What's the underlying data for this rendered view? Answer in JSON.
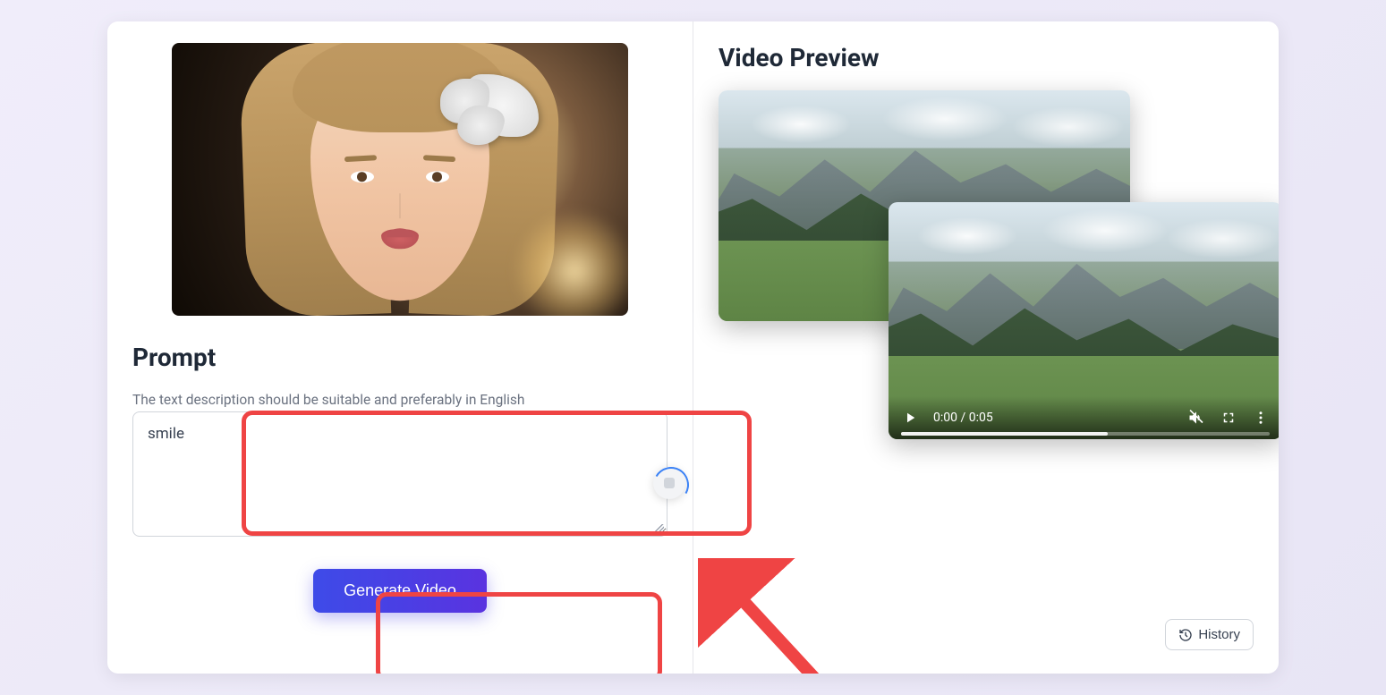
{
  "left": {
    "prompt_heading": "Prompt",
    "hint": "The text description should be suitable and preferably in English",
    "prompt_value": "smile",
    "generate_label": "Generate Video"
  },
  "right": {
    "preview_heading": "Video Preview",
    "time_display": "0:00 / 0:05",
    "history_label": "History"
  }
}
